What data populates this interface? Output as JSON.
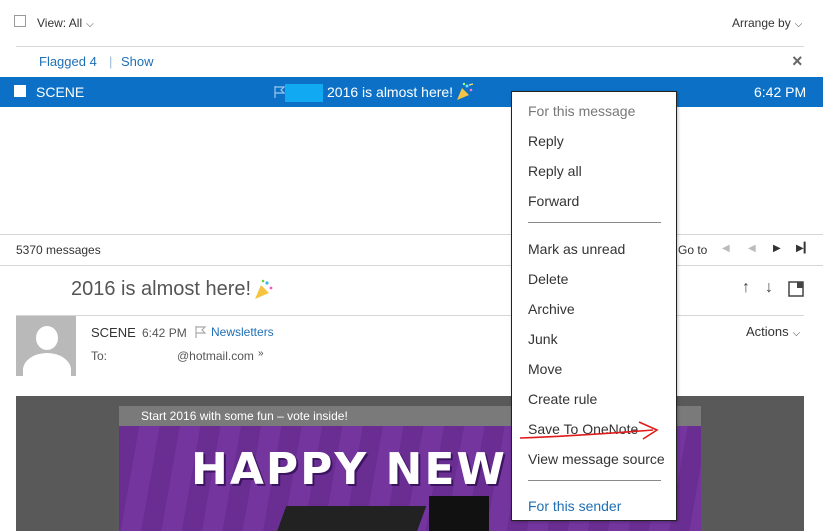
{
  "toolbar": {
    "view_label": "View: All",
    "arrange_label": "Arrange by"
  },
  "flagged_bar": {
    "flagged_label": "Flagged 4",
    "separator": "|",
    "show_label": "Show"
  },
  "selected_message": {
    "sender": "SCENE",
    "subject": "2016 is almost here!",
    "time": "6:42 PM"
  },
  "list_footer": {
    "count": "5370 messages",
    "goto_label": "Go to"
  },
  "reading_pane": {
    "subject": "2016 is almost here!",
    "sender": "SCENE",
    "time": "6:42 PM",
    "category": "Newsletters",
    "to_label": "To:",
    "to_address": "@hotmail.com",
    "actions_label": "Actions"
  },
  "banner": {
    "title": "Start 2016 with some fun – vote inside!",
    "headline": "HAPPY NEW Y"
  },
  "context_menu": {
    "header": "For this message",
    "items_group1": [
      "Reply",
      "Reply all",
      "Forward"
    ],
    "items_group2": [
      "Mark as unread",
      "Delete",
      "Archive",
      "Junk",
      "Move",
      "Create rule",
      "Save To OneNote",
      "View message source"
    ],
    "footer": "For this sender"
  },
  "colors": {
    "selection_blue": "#0c71c6",
    "link_blue": "#1f6fb5",
    "annotation_red": "#e01b1b"
  }
}
